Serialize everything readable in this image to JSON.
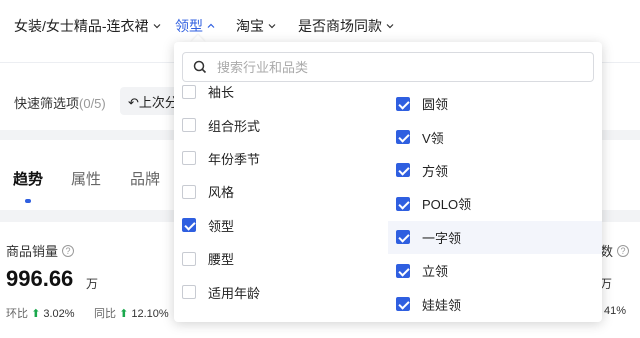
{
  "filters": [
    {
      "label": "女装/女士精品-连衣裙",
      "caret": "down"
    },
    {
      "label": "领型",
      "caret": "up"
    },
    {
      "label": "淘宝",
      "caret": "down"
    },
    {
      "label": "是否商场同款",
      "caret": "down"
    }
  ],
  "quick": {
    "label": "快速筛选项",
    "count": "(0/5)",
    "last_button": "上次分"
  },
  "tabs": [
    "趋势",
    "属性",
    "品牌"
  ],
  "metric": {
    "title": "商品销量",
    "value": "996.66",
    "unit": "万",
    "mom_label": "环比",
    "mom_value": "3.02%",
    "yoy_label": "同比",
    "yoy_value": "12.10%",
    "right_title": "数",
    "right_unit": "万",
    "right_trend": "41%"
  },
  "dropdown": {
    "search_placeholder": "搜索行业和品类",
    "left_options": [
      {
        "label": "袖长",
        "checked": false
      },
      {
        "label": "组合形式",
        "checked": false
      },
      {
        "label": "年份季节",
        "checked": false
      },
      {
        "label": "风格",
        "checked": false
      },
      {
        "label": "领型",
        "checked": true
      },
      {
        "label": "腰型",
        "checked": false
      },
      {
        "label": "适用年龄",
        "checked": false
      }
    ],
    "right_options": [
      {
        "label": "圆领",
        "checked": true
      },
      {
        "label": "V领",
        "checked": true
      },
      {
        "label": "方领",
        "checked": true
      },
      {
        "label": "POLO领",
        "checked": true
      },
      {
        "label": "一字领",
        "checked": true,
        "highlighted": true
      },
      {
        "label": "立领",
        "checked": true
      },
      {
        "label": "娃娃领",
        "checked": true
      }
    ]
  },
  "colors": {
    "accent": "#2f5fe0",
    "up": "#1aa84c",
    "band": "#f2f3f5"
  }
}
